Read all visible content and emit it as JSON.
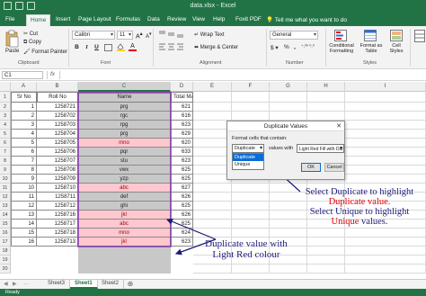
{
  "window": {
    "title": "data.xlsx - Excel"
  },
  "tabs": [
    "File",
    "Home",
    "Insert",
    "Page Layout",
    "Formulas",
    "Data",
    "Review",
    "View",
    "Help",
    "Foxit PDF"
  ],
  "active_tab": "Home",
  "tell_me": "Tell me what you want to do",
  "ribbon": {
    "clipboard": {
      "paste": "Paste",
      "cut": "Cut",
      "copy": "Copy",
      "format_painter": "Format Painter",
      "label": "Clipboard"
    },
    "font": {
      "name": "Calibri",
      "size": "11",
      "bold": "B",
      "italic": "I",
      "underline": "U",
      "label": "Font"
    },
    "alignment": {
      "wrap": "Wrap Text",
      "merge": "Merge & Center",
      "label": "Alignment"
    },
    "number": {
      "format": "General",
      "label": "Number"
    },
    "styles": {
      "conditional": "Conditional Formatting",
      "format_as_table": "Format as Table",
      "cell_styles": "Cell Styles",
      "label": "Styles"
    }
  },
  "formula_bar": {
    "name_box": "C1",
    "fx": "fx"
  },
  "columns": [
    "A",
    "B",
    "C",
    "D",
    "E",
    "F",
    "G",
    "H",
    "I"
  ],
  "row_numbers": [
    "1",
    "2",
    "3",
    "4",
    "5",
    "6",
    "7",
    "8",
    "9",
    "10",
    "11",
    "12",
    "13",
    "14",
    "15",
    "16",
    "17",
    "18",
    "19",
    "20"
  ],
  "table": {
    "headers": [
      "Sr No",
      "Roll No",
      "Name",
      "Total Marks"
    ],
    "rows": [
      [
        "1",
        "1258721",
        "prg",
        "621"
      ],
      [
        "2",
        "1258702",
        "rgc",
        "616"
      ],
      [
        "3",
        "1258703",
        "rpg",
        "623"
      ],
      [
        "4",
        "1258704",
        "prg",
        "629"
      ],
      [
        "5",
        "1258705",
        "mno",
        "620"
      ],
      [
        "6",
        "1258706",
        "pqr",
        "633"
      ],
      [
        "7",
        "1258707",
        "stu",
        "623"
      ],
      [
        "8",
        "1258708",
        "vwx",
        "625"
      ],
      [
        "9",
        "1258709",
        "yzp",
        "625"
      ],
      [
        "10",
        "1258710",
        "abc",
        "627"
      ],
      [
        "11",
        "1258711",
        "def",
        "626"
      ],
      [
        "12",
        "1258712",
        "ghi",
        "625"
      ],
      [
        "13",
        "1258716",
        "jkl",
        "626"
      ],
      [
        "14",
        "1258717",
        "abc",
        "625"
      ],
      [
        "15",
        "1258718",
        "mno",
        "624"
      ],
      [
        "16",
        "1258713",
        "jkl",
        "623"
      ]
    ],
    "duplicate_rows": [
      4,
      9,
      12,
      13,
      14,
      15
    ]
  },
  "dialog": {
    "title": "Duplicate Values",
    "close": "✕",
    "label": "Format cells that contain:",
    "select_value": "Duplicate",
    "values_with": "values with",
    "format_value": "Light Red Fill with Dark Red Text",
    "options": [
      "Duplicate",
      "Unique"
    ],
    "ok": "OK",
    "cancel": "Cancel"
  },
  "annotations": {
    "right_line1": "Select Duplicate to highlight",
    "right_line2": "Duplicate value.",
    "right_line3": "Select Unique to highlight",
    "right_line4_word": "Unique",
    "right_line4_rest": " values.",
    "bottom_line1": "Duplicate value with",
    "bottom_line2": "Light Red colour"
  },
  "sheet_tabs": [
    "Sheet3",
    "Sheet1",
    "Sheet2"
  ],
  "active_sheet": "Sheet1",
  "status": "Ready",
  "colors": {
    "excel_green": "#217346",
    "duplicate_fill": "#ffc7ce",
    "duplicate_text": "#9c0006",
    "selection_gray": "#c8c8c8",
    "annotation_purple": "#8b3fb0",
    "annotation_red": "#e00000",
    "arrow_blue": "#1c1c7a"
  }
}
